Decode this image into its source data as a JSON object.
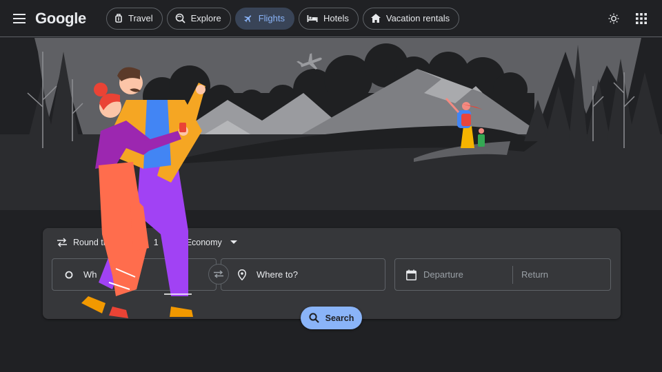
{
  "header": {
    "logo": "Google",
    "tabs": [
      {
        "label": "Travel",
        "icon": "travel-icon"
      },
      {
        "label": "Explore",
        "icon": "explore-icon"
      },
      {
        "label": "Flights",
        "icon": "flight-icon",
        "active": true
      },
      {
        "label": "Hotels",
        "icon": "hotel-icon"
      },
      {
        "label": "Vacation rentals",
        "icon": "house-icon"
      }
    ]
  },
  "search": {
    "trip_type": "Round tri",
    "passengers": "1",
    "cabin_class": "Economy",
    "from_partial": "Wh",
    "to_placeholder": "Where to?",
    "departure_placeholder": "Departure",
    "return_placeholder": "Return",
    "button_label": "Search"
  },
  "colors": {
    "background": "#202124",
    "card": "#36373a",
    "accent": "#8ab4f8",
    "active_chip": "#394457"
  }
}
